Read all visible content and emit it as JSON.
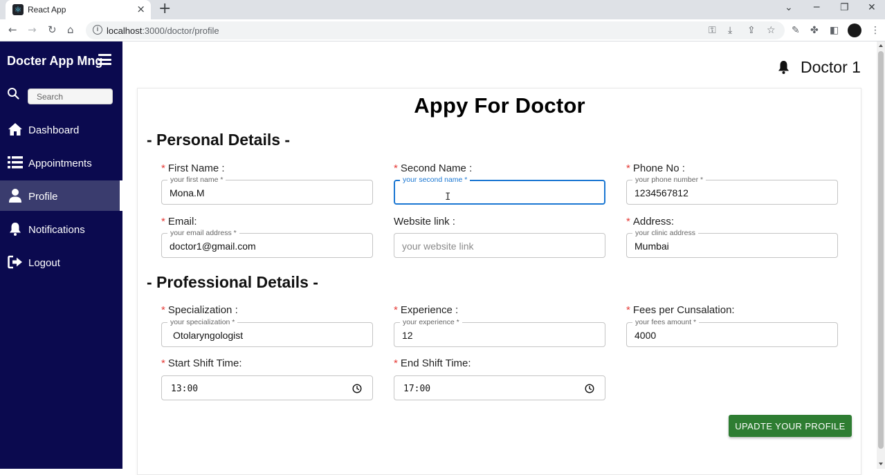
{
  "browser": {
    "tab_title": "React App",
    "url_host": "localhost",
    "url_path": ":3000/doctor/profile",
    "new_tab": "+",
    "close": "×"
  },
  "sidebar": {
    "brand": "Docter App Mng",
    "search_placeholder": "Search",
    "items": [
      {
        "label": "Dashboard",
        "icon": "home-icon",
        "active": false
      },
      {
        "label": "Appointments",
        "icon": "list-icon",
        "active": false
      },
      {
        "label": "Profile",
        "icon": "user-icon",
        "active": true
      },
      {
        "label": "Notifications",
        "icon": "bell-icon",
        "active": false
      },
      {
        "label": "Logout",
        "icon": "logout-icon",
        "active": false
      }
    ]
  },
  "header": {
    "user_name": "Doctor 1"
  },
  "page": {
    "title": "Appy For Doctor",
    "personal_section": "- Personal Details -",
    "professional_section": "- Professional Details -",
    "submit_label": "UPADTE YOUR PROFILE"
  },
  "form": {
    "first_name": {
      "label": "First Name :",
      "legend": "your first name *",
      "value": "Mona.M"
    },
    "second_name": {
      "label": "Second Name :",
      "legend": "your second name *",
      "value": ""
    },
    "phone": {
      "label": "Phone No :",
      "legend": "your phone number *",
      "value": "1234567812"
    },
    "email": {
      "label": "Email:",
      "legend": "your email address *",
      "value": "doctor1@gmail.com"
    },
    "website": {
      "label": "Website link :",
      "placeholder": "your website link",
      "value": ""
    },
    "address": {
      "label": "Address:",
      "legend": "your clinic address",
      "value": "Mumbai"
    },
    "specialization": {
      "label": "Specialization :",
      "legend": "your specialization *",
      "value": "Otolaryngologist"
    },
    "experience": {
      "label": "Experience :",
      "legend": "your experience *",
      "value": "12"
    },
    "fees": {
      "label": "Fees per Cunsalation:",
      "legend": "your fees amount *",
      "value": "4000"
    },
    "start_time": {
      "label": "Start Shift Time:",
      "value": "13:00"
    },
    "end_time": {
      "label": "End Shift Time:",
      "value": "17:00"
    }
  },
  "colors": {
    "sidebar_bg": "#0b0a4f",
    "active_item_bg": "#3a3c6e",
    "required": "#e53935",
    "focus": "#1976d2",
    "submit_bg": "#2e7d32"
  }
}
